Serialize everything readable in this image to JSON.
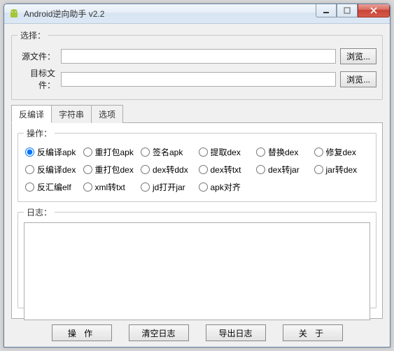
{
  "window": {
    "title": "Android逆向助手 v2.2"
  },
  "select_group": {
    "legend": "选择：",
    "source_label": "源文件：",
    "source_value": "",
    "target_label": "目标文件：",
    "target_value": "",
    "browse": "浏览..."
  },
  "tabs": [
    {
      "label": "反编译",
      "active": true
    },
    {
      "label": "字符串",
      "active": false
    },
    {
      "label": "选项",
      "active": false
    }
  ],
  "ops": {
    "legend": "操作：",
    "items": [
      {
        "label": "反编译apk",
        "checked": true
      },
      {
        "label": "重打包apk",
        "checked": false
      },
      {
        "label": "签名apk",
        "checked": false
      },
      {
        "label": "提取dex",
        "checked": false
      },
      {
        "label": "替换dex",
        "checked": false
      },
      {
        "label": "修复dex",
        "checked": false
      },
      {
        "label": "反编译dex",
        "checked": false
      },
      {
        "label": "重打包dex",
        "checked": false
      },
      {
        "label": "dex转ddx",
        "checked": false
      },
      {
        "label": "dex转txt",
        "checked": false
      },
      {
        "label": "dex转jar",
        "checked": false
      },
      {
        "label": "jar转dex",
        "checked": false
      },
      {
        "label": "反汇编elf",
        "checked": false
      },
      {
        "label": "xml转txt",
        "checked": false
      },
      {
        "label": "jd打开jar",
        "checked": false
      },
      {
        "label": "apk对齐",
        "checked": false
      }
    ]
  },
  "log": {
    "legend": "日志：",
    "content": ""
  },
  "buttons": {
    "operate": "操 作",
    "clear": "清空日志",
    "export": "导出日志",
    "about": "关 于"
  }
}
